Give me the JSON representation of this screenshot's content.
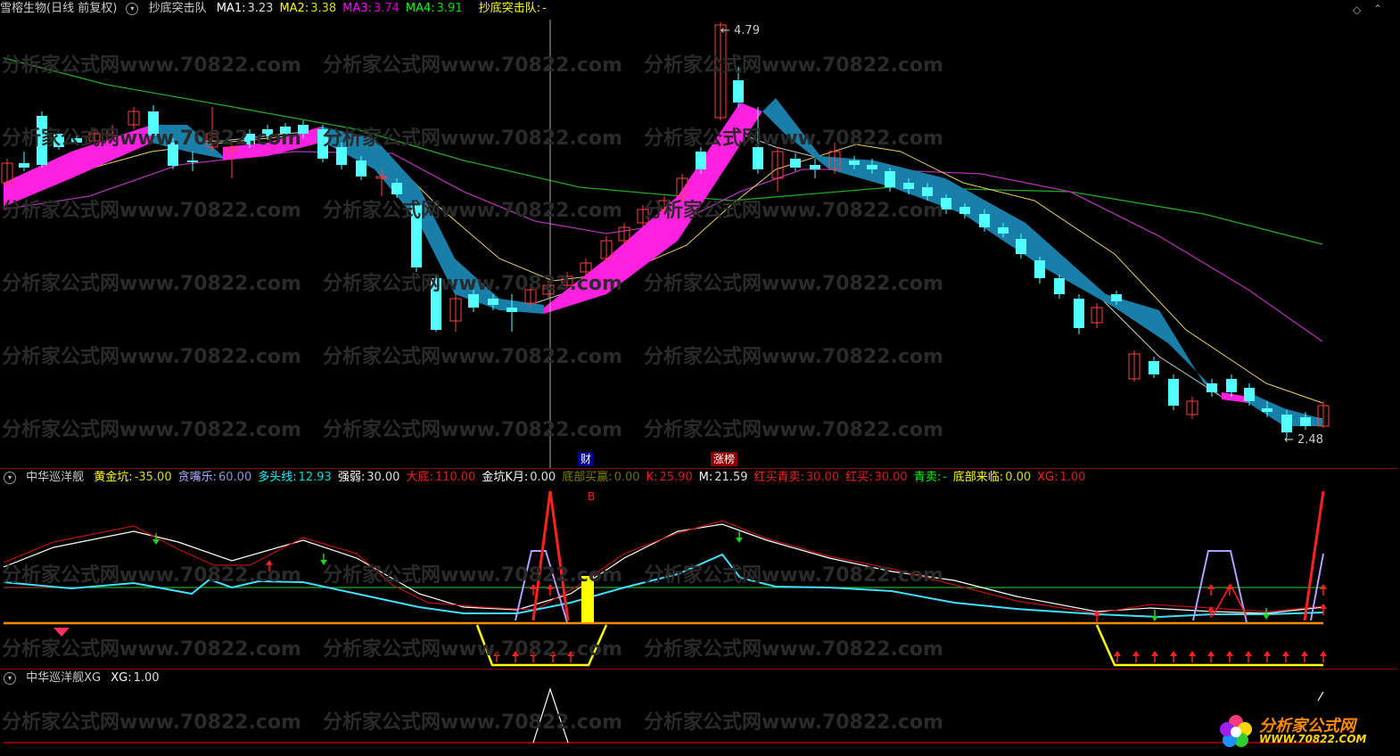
{
  "main": {
    "title": "雪榕生物(日线 前复权)",
    "indicator_name": "抄底突击队",
    "ma": [
      {
        "label": "MA1:",
        "value": "3.23",
        "color": "#ffffff"
      },
      {
        "label": "MA2:",
        "value": "3.38",
        "color": "#ffff00"
      },
      {
        "label": "MA3:",
        "value": "3.74",
        "color": "#ff00ff"
      },
      {
        "label": "MA4:",
        "value": "3.91",
        "color": "#00ff00"
      }
    ],
    "signal_label": "抄底突击队:",
    "signal_value": "-",
    "high_label": "4.79",
    "low_label": "2.48",
    "badge_cai": "财",
    "badge_zhangbang": "涨榜"
  },
  "sub1": {
    "name": "中华巡洋舰",
    "items": [
      {
        "label": "黄金坑:",
        "value": "-35.00",
        "color": "#ffff00"
      },
      {
        "label": "贪嘴乐:",
        "value": "60.00",
        "color": "#aaaaff"
      },
      {
        "label": "多头线:",
        "value": "12.93",
        "color": "#00ffff"
      },
      {
        "label": "强弱:",
        "value": "30.00",
        "color": "#ffffff"
      },
      {
        "label": "大底:",
        "value": "110.00",
        "color": "#ff2020"
      },
      {
        "label": "金坑K月:",
        "value": "0.00",
        "color": "#ffffff"
      },
      {
        "label": "底部买赢:",
        "value": "0.00",
        "color": "#808000"
      },
      {
        "label": "K:",
        "value": "25.90",
        "color": "#ff2020"
      },
      {
        "label": "M:",
        "value": "21.59",
        "color": "#ffffff"
      },
      {
        "label": "红买青卖:",
        "value": "30.00",
        "color": "#ff2020"
      },
      {
        "label": "红买:",
        "value": "30.00",
        "color": "#ff2020"
      },
      {
        "label": "青卖:",
        "value": "-",
        "color": "#00ff00"
      },
      {
        "label": "底部来临:",
        "value": "0.00",
        "color": "#ffff00"
      },
      {
        "label": "XG:",
        "value": "1.00",
        "color": "#ff2020"
      }
    ],
    "b_marker": "B"
  },
  "sub2": {
    "name": "中华巡洋舰XG",
    "items": [
      {
        "label": "XG:",
        "value": "1.00",
        "color": "#ffffff"
      }
    ]
  },
  "watermark": "分析家公式网www.70822.com",
  "logo": {
    "line1": "分析家公式网",
    "line2": "WWW.70822.COM"
  }
}
